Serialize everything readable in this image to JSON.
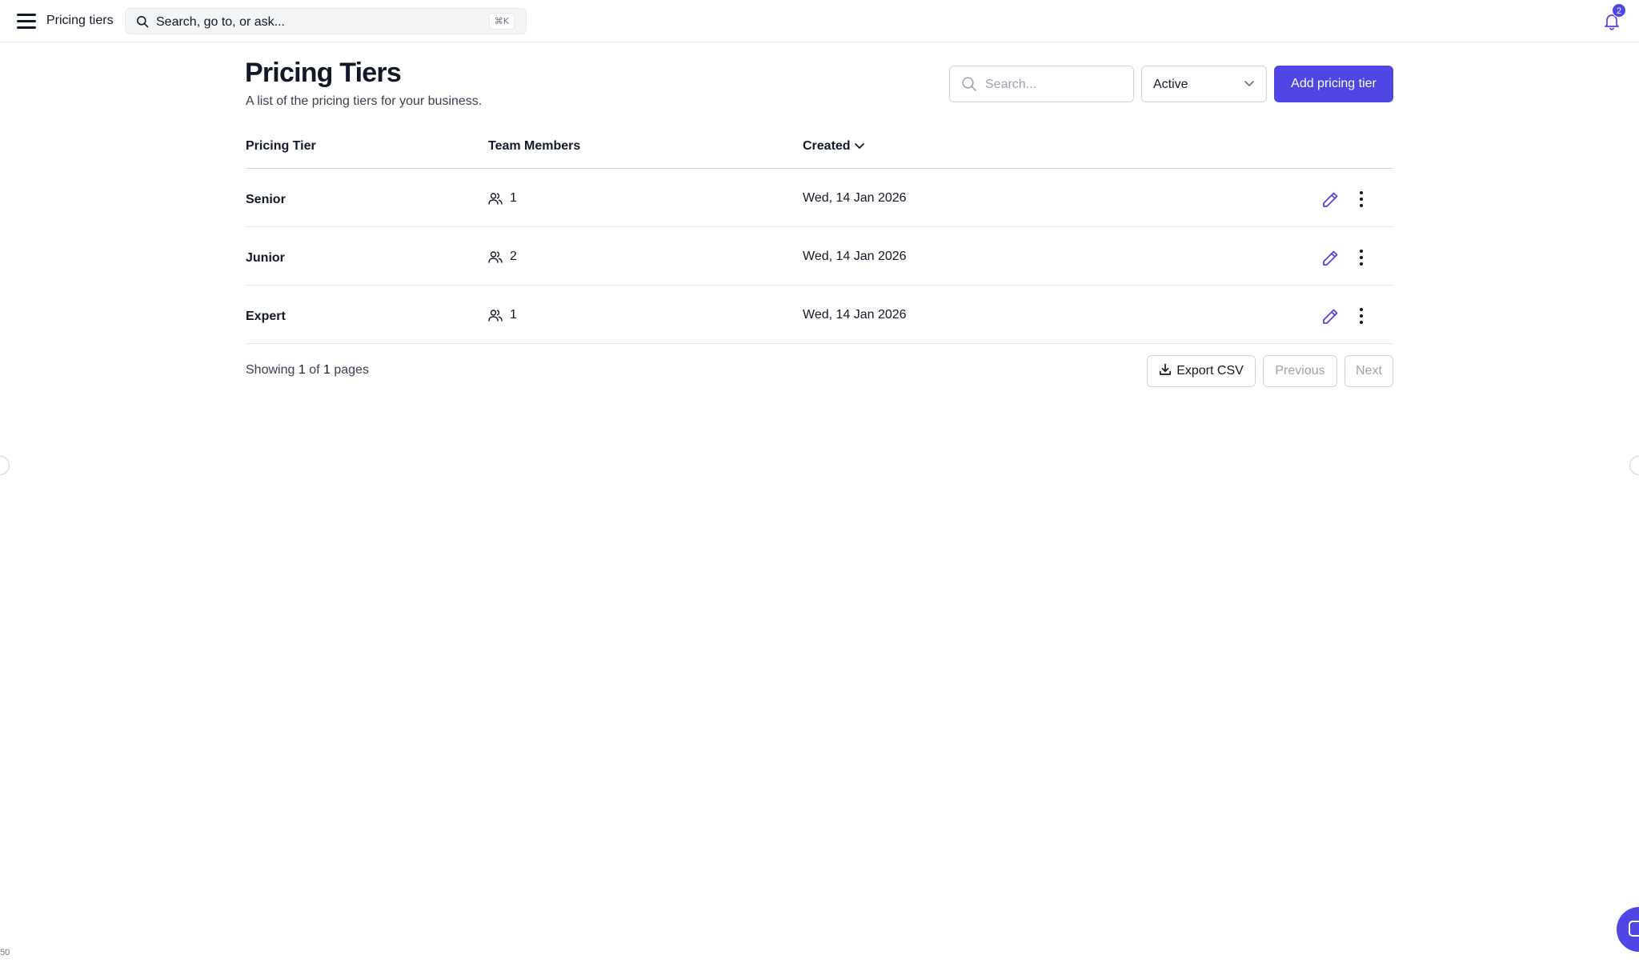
{
  "topbar": {
    "menu_icon": "hamburger-icon",
    "title": "Pricing tiers",
    "search_placeholder": "Search, go to, or ask...",
    "shortcut": "⌘K",
    "notifications_count": "2"
  },
  "header": {
    "title": "Pricing Tiers",
    "subtitle": "A list of the pricing tiers for your business.",
    "search_placeholder": "Search...",
    "status_filter": "Active",
    "add_label": "Add pricing tier"
  },
  "table": {
    "columns": [
      "Pricing Tier",
      "Team Members",
      "Created"
    ],
    "rows": [
      {
        "tier": "Senior",
        "members": "1",
        "created": "Wed, 14 Jan 2026"
      },
      {
        "tier": "Junior",
        "members": "2",
        "created": "Wed, 14 Jan 2026"
      },
      {
        "tier": "Expert",
        "members": "1",
        "created": "Wed, 14 Jan 2026"
      }
    ]
  },
  "footer": {
    "showing_prefix": "Showing",
    "current_page": "1",
    "of_word": "of",
    "total_pages": "1",
    "pages_word": "pages",
    "export_label": "Export CSV",
    "previous_label": "Previous",
    "next_label": "Next"
  },
  "misc": {
    "corner_text": "50"
  },
  "colors": {
    "accent": "#4f46e5",
    "text": "#111827",
    "muted": "#9ca3af",
    "border": "#e5e7eb"
  }
}
